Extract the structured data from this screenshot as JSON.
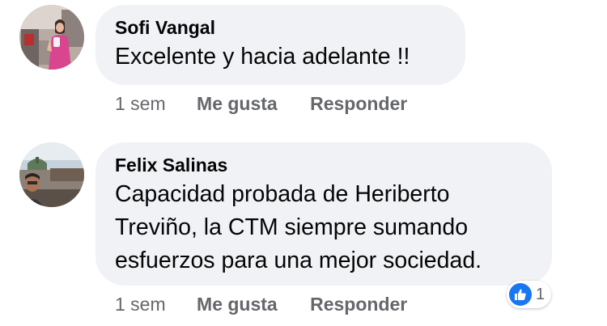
{
  "comments": [
    {
      "author": "Sofi Vangal",
      "text": "Excelente y hacia adelante !!",
      "time": "1 sem",
      "like_label": "Me gusta",
      "reply_label": "Responder"
    },
    {
      "author": "Felix Salinas",
      "text": "Capacidad probada de Heriberto\nTreviño, la CTM siempre sumando\nesfuerzos para una mejor sociedad.",
      "time": "1 sem",
      "like_label": "Me gusta",
      "reply_label": "Responder",
      "reaction": {
        "icon": "thumbs-up-icon",
        "count": "1"
      }
    }
  ],
  "colors": {
    "bubble": "#f0f2f5",
    "text": "#050505",
    "secondary": "#65676b",
    "like_blue": "#1877f2"
  }
}
